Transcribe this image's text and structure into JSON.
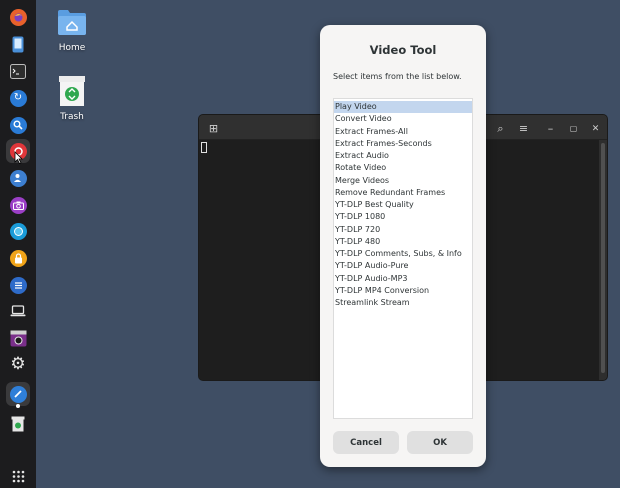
{
  "desktop": {
    "icons": [
      {
        "label": "Home"
      },
      {
        "label": "Trash"
      }
    ]
  },
  "dock": {
    "items": [
      {
        "name": "firefox-icon",
        "color": "#e8612c"
      },
      {
        "name": "phone-icon",
        "color": "#4a90d9"
      },
      {
        "name": "terminal-icon",
        "color": "#2d2d2d"
      },
      {
        "name": "refresh-icon",
        "color": "#2a7bd6"
      },
      {
        "name": "search-icon",
        "color": "#2a7bd6"
      },
      {
        "name": "lifebuoy-icon",
        "color": "#e0363a"
      },
      {
        "name": "user-settings-icon",
        "color": "#3d7fd0"
      },
      {
        "name": "camera-icon",
        "color": "#9b3fc6"
      },
      {
        "name": "browser-icon",
        "color": "#1a9bd8"
      },
      {
        "name": "lock-icon",
        "color": "#f0a419"
      },
      {
        "name": "list-icon",
        "color": "#2e6bc9"
      },
      {
        "name": "laptop-icon",
        "color": "#e6e6e6"
      },
      {
        "name": "media-player-icon",
        "color": "#7a2f8a"
      },
      {
        "name": "gear-icon",
        "color": "#e6e6e6"
      },
      {
        "name": "video-tool-icon",
        "color": "#2f7fd8"
      },
      {
        "name": "trash-icon",
        "color": "#2fa84f"
      },
      {
        "name": "app-grid-icon",
        "color": "#e6e6e6"
      }
    ]
  },
  "terminal": {
    "new_tab_glyph": "⊞",
    "search_glyph": "⌕",
    "menu_glyph": "≡",
    "minimize_glyph": "–",
    "maximize_glyph": "▢",
    "close_glyph": "✕"
  },
  "dialog": {
    "title": "Video Tool",
    "message": "Select items from the list below.",
    "items": [
      "Play Video",
      "Convert Video",
      "Extract Frames-All",
      "Extract Frames-Seconds",
      "Extract Audio",
      "Rotate Video",
      "Merge Videos",
      "Remove Redundant Frames",
      "YT-DLP Best Quality",
      "YT-DLP 1080",
      "YT-DLP 720",
      "YT-DLP 480",
      "YT-DLP Comments, Subs, & Info",
      "YT-DLP Audio-Pure",
      "YT-DLP Audio-MP3",
      "YT-DLP MP4 Conversion",
      "Streamlink Stream"
    ],
    "selected_index": 0,
    "cancel_label": "Cancel",
    "ok_label": "OK"
  },
  "colors": {
    "desktop_bg": "#3f4e64",
    "dock_bg": "#1c1c1e",
    "selection": "#c3d6ee"
  }
}
